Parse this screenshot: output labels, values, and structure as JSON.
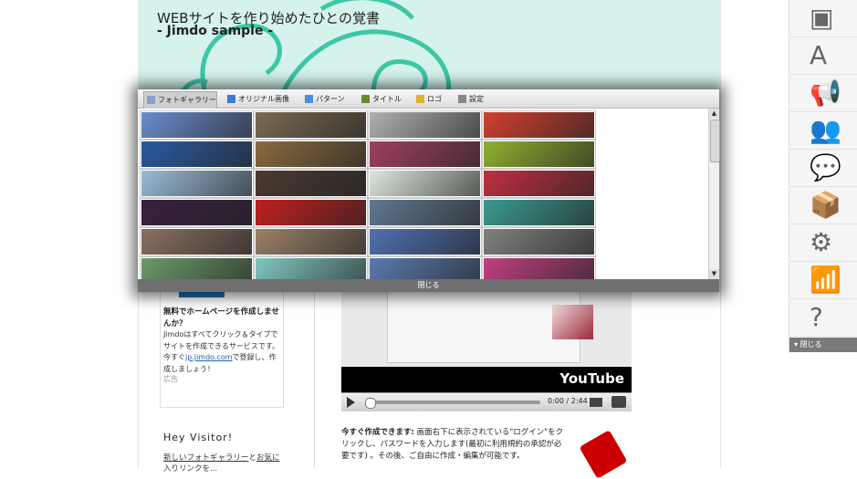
{
  "site": {
    "title": "WEBサイトを作り始めたひとの覚書",
    "subtitle": "- Jimdo sample -"
  },
  "sidebar_ad": {
    "title": "無料でホームページを作成しませんか？",
    "text_before_link": "Jimdoはすべてクリック＆タイプでサイトを作成できるサービスです。今すぐ",
    "link": "jp.jimdo.com",
    "text_after_link": "で登録し、作成しましょう！",
    "label": "広告"
  },
  "visitor": {
    "heading": "Hey Visitor!",
    "link1": "新しいフォトギャラリー",
    "mid": "と",
    "link2": "お気に",
    "line2": "入りリンクを..."
  },
  "video": {
    "logo": "YouTube",
    "time": "0:00 / 2:44"
  },
  "main_text": {
    "bold": "今すぐ作成できます:",
    "body": " 画面右下に表示されている\"ログイン\"をクリックし、パスワードを入力します(最初に利用規約の承認が必要です) 。その後、ご自由に作成・編集が可能です。"
  },
  "dialog": {
    "tabs": [
      {
        "label": "フォトギャラリー",
        "icon": "photo-icon",
        "color": "#8aa0c8"
      },
      {
        "label": "オリジナル画像",
        "icon": "upload-icon",
        "color": "#3a7bd5"
      },
      {
        "label": "パターン",
        "icon": "pattern-icon",
        "color": "#4a8ee0"
      },
      {
        "label": "タイトル",
        "icon": "pencil-icon",
        "color": "#6a8a30"
      },
      {
        "label": "ロゴ",
        "icon": "folder-icon",
        "color": "#e0b030"
      },
      {
        "label": "設定",
        "icon": "gear-icon",
        "color": "#888888"
      }
    ],
    "active_tab": "フォトギャラリー",
    "close_label": "閉じる",
    "thumbnails": [
      [
        "#6a8ccc",
        "#7a6a50",
        "#b0b0b0",
        "#d04030"
      ],
      [
        "#2a5aa0",
        "#8a6a40",
        "#a04060",
        "#90b030"
      ],
      [
        "#9abcd8",
        "#4a3a30",
        "#dde8dd",
        "#c03040"
      ],
      [
        "#3a2040",
        "#c02020",
        "#607890",
        "#3a9a90"
      ],
      [
        "#8a7060",
        "#9a8068",
        "#5070b0",
        "#808080"
      ],
      [
        "#6a9a6a",
        "#80c8c0",
        "#5a7ab0",
        "#c04080"
      ]
    ]
  },
  "right_toolbar": {
    "items": [
      {
        "name": "layout-icon",
        "glyph": "▣"
      },
      {
        "name": "style-icon",
        "glyph": "A"
      },
      {
        "name": "announce-icon",
        "glyph": "📢"
      },
      {
        "name": "users-icon",
        "glyph": "👥"
      },
      {
        "name": "comments-icon",
        "glyph": "💬"
      },
      {
        "name": "box-icon",
        "glyph": "📦"
      },
      {
        "name": "gear-icon",
        "glyph": "⚙"
      },
      {
        "name": "stats-icon",
        "glyph": "📶"
      },
      {
        "name": "help-icon",
        "glyph": "?"
      }
    ],
    "close_label": "閉じる"
  }
}
